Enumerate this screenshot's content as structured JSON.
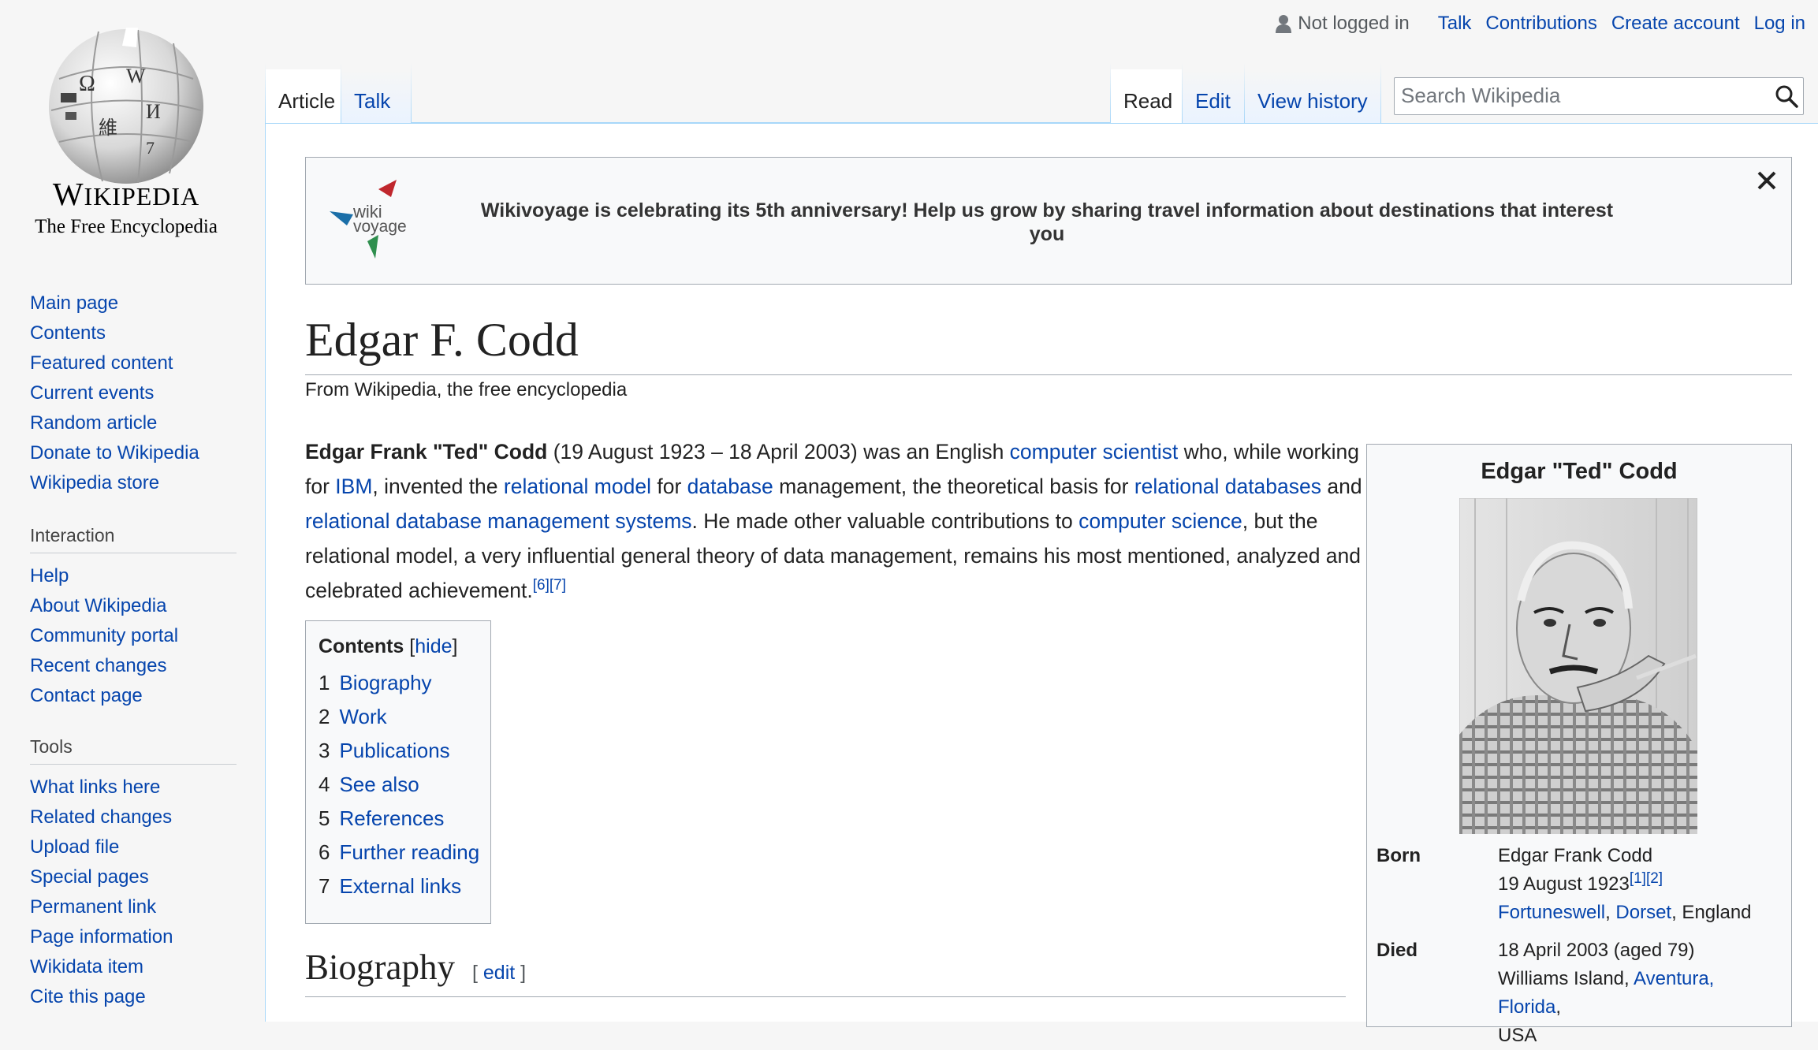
{
  "logo": {
    "wordmark_first": "W",
    "wordmark_rest": "IKIPEDIA",
    "tagline": "The Free Encyclopedia"
  },
  "sidebar": {
    "navigation": [
      "Main page",
      "Contents",
      "Featured content",
      "Current events",
      "Random article",
      "Donate to Wikipedia",
      "Wikipedia store"
    ],
    "interaction": {
      "heading": "Interaction",
      "items": [
        "Help",
        "About Wikipedia",
        "Community portal",
        "Recent changes",
        "Contact page"
      ]
    },
    "tools": {
      "heading": "Tools",
      "items": [
        "What links here",
        "Related changes",
        "Upload file",
        "Special pages",
        "Permanent link",
        "Page information",
        "Wikidata item",
        "Cite this page"
      ]
    }
  },
  "personal": {
    "not_logged_in": "Not logged in",
    "talk": "Talk",
    "contributions": "Contributions",
    "create_account": "Create account",
    "log_in": "Log in"
  },
  "tabs": {
    "article": "Article",
    "talk": "Talk",
    "read": "Read",
    "edit": "Edit",
    "view_history": "View history"
  },
  "search": {
    "placeholder": "Search Wikipedia",
    "icon": "search-icon"
  },
  "banner": {
    "logo_text_1": "wiki",
    "logo_text_2": "voyage",
    "message": "Wikivoyage is celebrating its 5th anniversary! Help us grow by sharing travel information about destinations that interest you",
    "close_icon": "close-icon"
  },
  "article": {
    "title": "Edgar F. Codd",
    "subtitle": "From Wikipedia, the free encyclopedia",
    "lead": {
      "bold_name": "Edgar Frank \"Ted\" Codd",
      "t1": " (19 August 1923 – 18 April 2003) was an English ",
      "l1": "computer scientist",
      "t2": " who, while working for ",
      "l2": "IBM",
      "t3": ", invented the ",
      "l3": "relational model",
      "t4": " for ",
      "l4": "database",
      "t5": " management, the theoretical basis for ",
      "l5": "relational databases",
      "t6": " and ",
      "l6": "relational database management systems",
      "t7": ". He made other valuable contributions to ",
      "l7": "computer science",
      "t8": ", but the relational model, a very influential general theory of data management, remains his most mentioned, analyzed and celebrated achievement.",
      "ref1": "[6]",
      "ref2": "[7]"
    },
    "toc": {
      "title": "Contents",
      "hide_open": "[",
      "hide": "hide",
      "hide_close": "]",
      "items": [
        {
          "num": "1",
          "label": "Biography"
        },
        {
          "num": "2",
          "label": "Work"
        },
        {
          "num": "3",
          "label": "Publications"
        },
        {
          "num": "4",
          "label": "See also"
        },
        {
          "num": "5",
          "label": "References"
        },
        {
          "num": "6",
          "label": "Further reading"
        },
        {
          "num": "7",
          "label": "External links"
        }
      ]
    },
    "biography_heading": "Biography",
    "edit_open": "[",
    "edit_label": "edit",
    "edit_close": "]"
  },
  "infobox": {
    "title": "Edgar \"Ted\" Codd",
    "born_label": "Born",
    "born_name": "Edgar Frank Codd",
    "born_date": "19 August 1923",
    "born_ref1": "[1]",
    "born_ref2": "[2]",
    "born_place_1": "Fortuneswell",
    "born_place_sep": ", ",
    "born_place_2": "Dorset",
    "born_place_3": ", England",
    "died_label": "Died",
    "died_date": "18 April 2003 (aged 79)",
    "died_place_1": "Williams Island, ",
    "died_place_2": "Aventura, Florida",
    "died_place_3": ",",
    "died_place_4": "USA"
  },
  "colors": {
    "link": "#0645ad",
    "tab_border": "#a7d7f9",
    "background": "#f6f6f6"
  }
}
